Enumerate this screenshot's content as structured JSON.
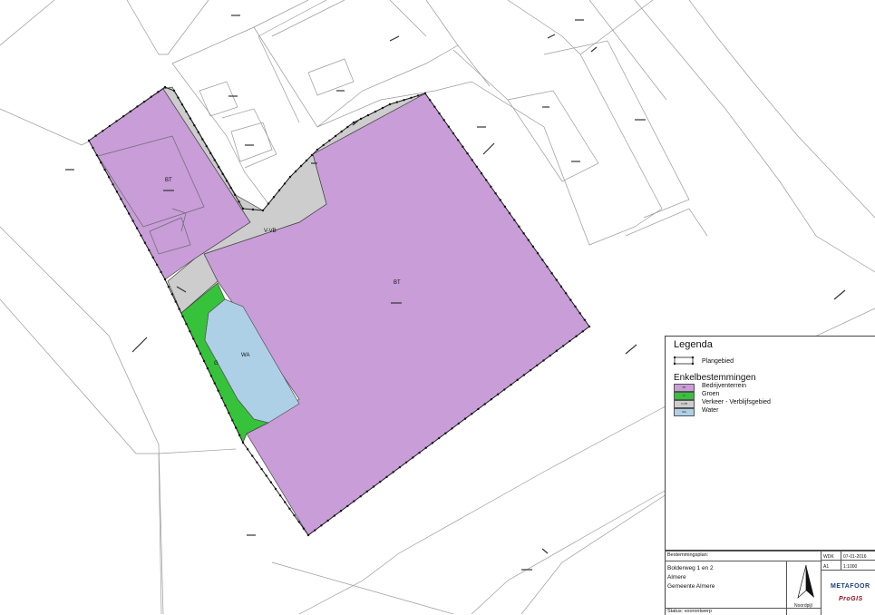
{
  "map": {
    "zones": {
      "bt_main": "BT",
      "bt_small": "BT",
      "verkeer": "V-VB",
      "groen": "G",
      "water": "WA"
    }
  },
  "legend": {
    "title": "Legenda",
    "plangebied_label": "Plangebied",
    "section_title": "Enkelbestemmingen",
    "items": [
      {
        "code": "BT",
        "label": "Bedrijventerrein",
        "color": "#c89dd8"
      },
      {
        "code": "G",
        "label": "Groen",
        "color": "#36c23a"
      },
      {
        "code": "V-VB",
        "label": "Verkeer - Verblijfsgebied",
        "color": "#cdcdcd"
      },
      {
        "code": "WA",
        "label": "Water",
        "color": "#aed0e6"
      }
    ]
  },
  "titleblock": {
    "header": "Bestemmingsplan:",
    "name_line1": "Bolderweg 1 en 2",
    "name_line2": "Almere",
    "name_line3": "Gemeente Almere",
    "status": "Status: voorontwerp",
    "north_label": "Noordpijl",
    "brand_metafoor": "METAFOOR",
    "brand_prog": "ProGIS",
    "gez": "WDK",
    "date": "07-01-2016",
    "format": "A1",
    "scale": "1:1000"
  },
  "colors": {
    "bt": "#c89dd8",
    "groen": "#36c23a",
    "verkeer": "#cdcdcd",
    "water": "#aed0e6"
  }
}
